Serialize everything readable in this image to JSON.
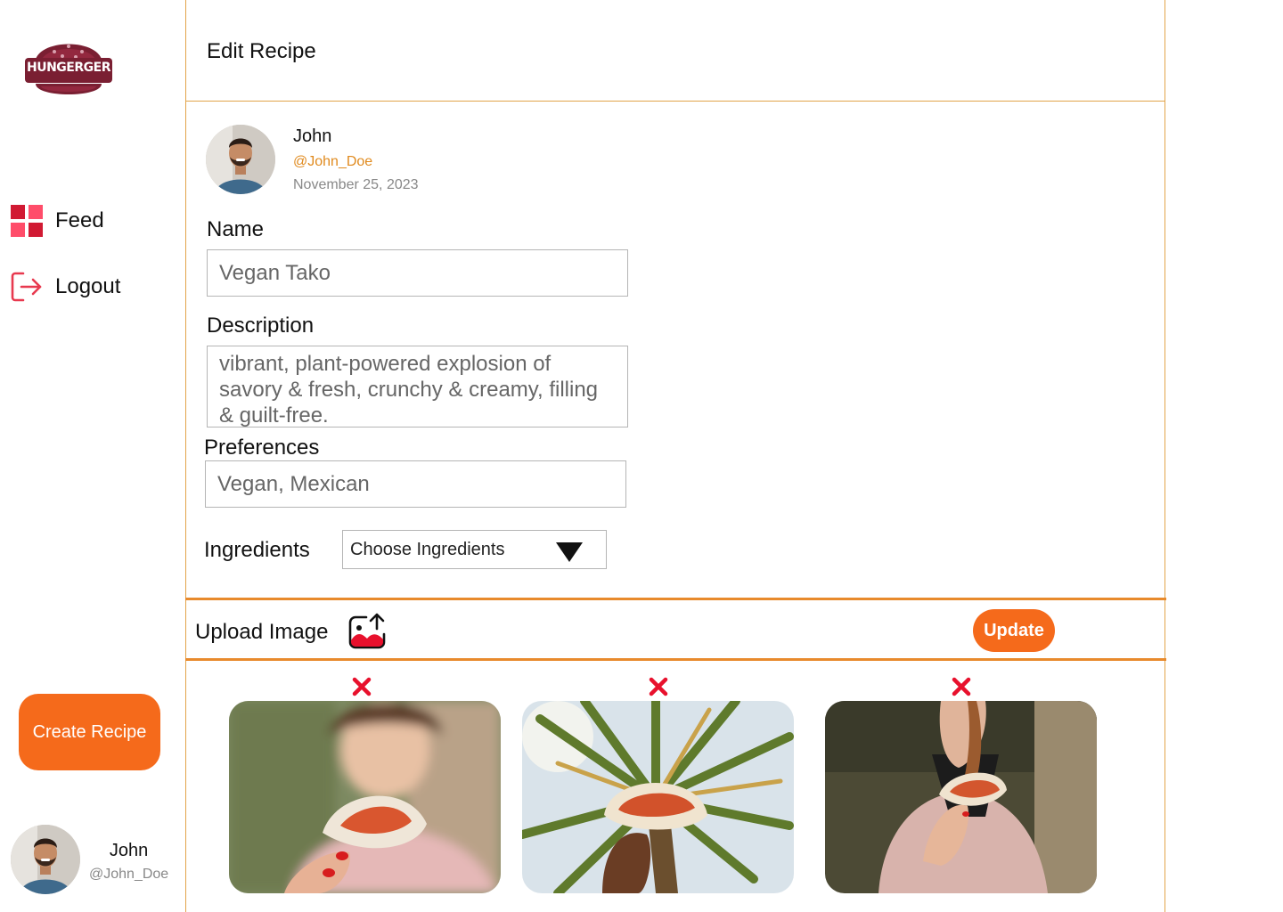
{
  "brand": {
    "name": "HUNGERGER",
    "primary": "#f56a1b",
    "logo_color": "#7a1f32"
  },
  "sidebar": {
    "items": [
      {
        "label": "Feed",
        "icon": "grid-icon"
      },
      {
        "label": "Logout",
        "icon": "logout-icon"
      }
    ],
    "create_label": "Create Recipe",
    "user": {
      "name": "John",
      "handle": "@John_Doe"
    }
  },
  "header": {
    "title": "Edit Recipe"
  },
  "author": {
    "name": "John",
    "handle": "@John_Doe",
    "date": "November 25, 2023"
  },
  "form": {
    "name_label": "Name",
    "name_value": "Vegan Tako",
    "description_label": "Description",
    "description_value": "vibrant, plant-powered explosion of savory & fresh, crunchy & creamy, filling & guilt-free.",
    "preferences_label": "Preferences",
    "preferences_value": "Vegan, Mexican",
    "ingredients_label": "Ingredients",
    "ingredients_placeholder": "Choose Ingredients"
  },
  "upload": {
    "label": "Upload Image",
    "update_label": "Update"
  },
  "images": [
    {
      "alt": "Person holding taco, blurred background"
    },
    {
      "alt": "Hand holding taco against palm tree"
    },
    {
      "alt": "Woman in pink jacket holding taco"
    }
  ]
}
